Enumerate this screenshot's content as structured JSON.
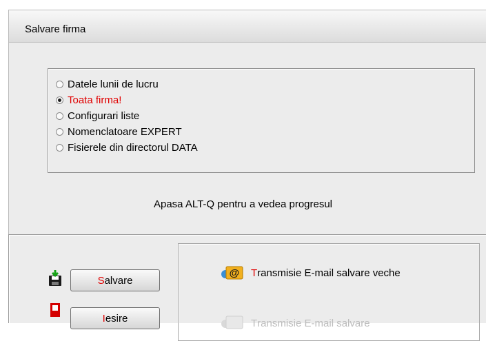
{
  "window": {
    "title": "Salvare firma"
  },
  "options": [
    {
      "label": "Datele lunii de lucru",
      "selected": false
    },
    {
      "label": "Toata firma!",
      "selected": true
    },
    {
      "label": "Configurari liste",
      "selected": false
    },
    {
      "label": "Nomenclatoare EXPERT",
      "selected": false
    },
    {
      "label": "Fisierele din directorul DATA",
      "selected": false
    }
  ],
  "hint": "Apasa ALT-Q pentru a vedea progresul",
  "buttons": {
    "save": {
      "hotkey": "S",
      "rest": "alvare"
    },
    "exit": {
      "hotkey": "I",
      "rest": "esire"
    }
  },
  "email_links": {
    "old": {
      "hotkey": "T",
      "rest": "ransmisie E-mail salvare veche"
    },
    "new": {
      "hotkey": "T",
      "rest": "ransmisie E-mail salvare"
    }
  },
  "icons": {
    "save_icon": "floppy-download-icon",
    "exit_icon": "exit-door-icon",
    "email_icon": "email-at-icon"
  },
  "colors": {
    "selected_option": "#e00000",
    "hotkey": "#e00000",
    "panel_bg": "#ececec"
  }
}
